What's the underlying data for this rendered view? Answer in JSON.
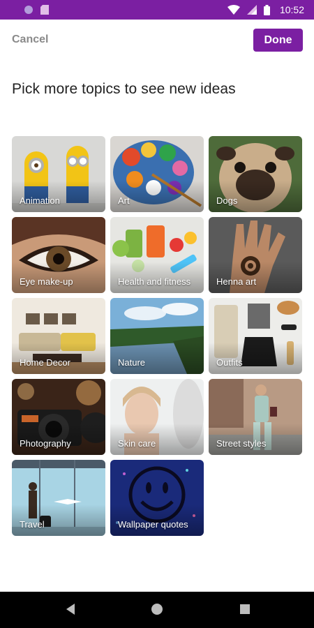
{
  "status_bar": {
    "time": "10:52",
    "icons": [
      "circle-notification-icon",
      "sd-card-icon",
      "wifi-icon",
      "signal-icon",
      "battery-icon"
    ],
    "background": "#7b1fa2"
  },
  "header": {
    "cancel_label": "Cancel",
    "done_label": "Done",
    "accent": "#7b1fa2"
  },
  "title": "Pick more topics to see new ideas",
  "topics": [
    {
      "label": "Animation",
      "icon": "minions-image"
    },
    {
      "label": "Art",
      "icon": "paint-palette-image"
    },
    {
      "label": "Dogs",
      "icon": "pug-image"
    },
    {
      "label": "Eye make-up",
      "icon": "eye-makeup-image"
    },
    {
      "label": "Health and fitness",
      "icon": "fruits-dumbbell-image"
    },
    {
      "label": "Henna art",
      "icon": "henna-hand-image"
    },
    {
      "label": "Home Decor",
      "icon": "living-room-image"
    },
    {
      "label": "Nature",
      "icon": "river-landscape-image"
    },
    {
      "label": "Outfits",
      "icon": "clothes-flatlay-image"
    },
    {
      "label": "Photography",
      "icon": "camera-image"
    },
    {
      "label": "Skin care",
      "icon": "woman-face-image"
    },
    {
      "label": "Street styles",
      "icon": "street-walker-image"
    },
    {
      "label": "Travel",
      "icon": "airport-window-image"
    },
    {
      "label": "Wallpaper quotes",
      "icon": "smiley-face-image"
    }
  ],
  "nav_bar": {
    "icons": [
      "back-icon",
      "home-icon",
      "recents-icon"
    ]
  }
}
